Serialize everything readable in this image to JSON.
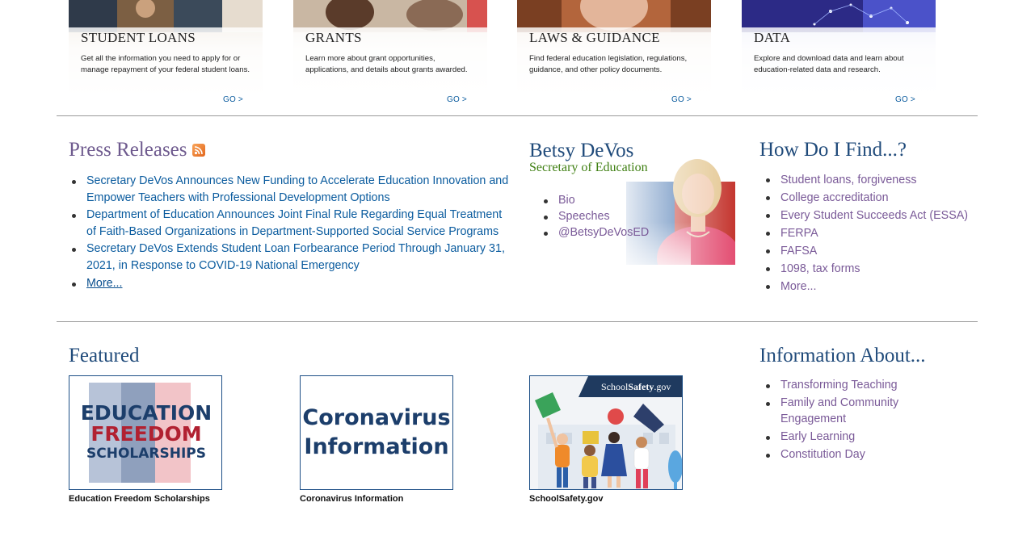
{
  "tiles": [
    {
      "title": "STUDENT LOANS",
      "desc": "Get all the information you need to apply for or manage repayment of your federal student loans.",
      "go": "GO >"
    },
    {
      "title": "GRANTS",
      "desc": "Learn more about grant opportunities, applications, and details about grants awarded.",
      "go": "GO >"
    },
    {
      "title": "LAWS & GUIDANCE",
      "desc": "Find federal education legislation, regulations, guidance, and other policy documents.",
      "go": "GO >"
    },
    {
      "title": "DATA",
      "desc": "Explore and download data and learn about education-related data and research.",
      "go": "GO >"
    }
  ],
  "press": {
    "title": "Press Releases",
    "items": [
      "Secretary DeVos Announces New Funding to Accelerate Education Innovation and Empower Teachers with Professional Development Options",
      "Department of Education Announces Joint Final Rule Regarding Equal Treatment of Faith-Based Organizations in Department-Supported Social Service Programs",
      "Secretary DeVos Extends Student Loan Forbearance Period Through January 31, 2021, in Response to COVID-19 National Emergency"
    ],
    "more": "More..."
  },
  "secretary": {
    "name": "Betsy DeVos",
    "role": "Secretary of Education",
    "links": [
      "Bio",
      "Speeches",
      "@BetsyDeVosED"
    ]
  },
  "find": {
    "title": "How Do I Find...?",
    "items": [
      "Student loans, forgiveness",
      "College accreditation",
      "Every Student Succeeds Act (ESSA)",
      "FERPA",
      "FAFSA",
      "1098, tax forms",
      "More..."
    ]
  },
  "featured": {
    "title": "Featured",
    "items": [
      {
        "caption": "Education Freedom Scholarships",
        "lines": [
          "EDUCATION",
          "FREEDOM",
          "SCHOLARSHIPS"
        ]
      },
      {
        "caption": "Coronavirus Information",
        "lines": [
          "Coronavirus",
          "Information"
        ]
      },
      {
        "caption": "SchoolSafety.gov",
        "banner_plain": "School",
        "banner_bold": "Safety",
        "banner_tld": ".gov"
      }
    ]
  },
  "info": {
    "title": "Information About...",
    "items": [
      "Transforming Teaching",
      "Family and Community Engagement",
      "Early Learning",
      "Constitution Day"
    ]
  },
  "colors": {
    "link_blue": "#0a5b9e",
    "heading_blue": "#1f4a7a",
    "heading_purple": "#6e5a8e",
    "secretary_green": "#3f7f12",
    "efs_navy": "#1c3e6b",
    "efs_red": "#b12131"
  }
}
